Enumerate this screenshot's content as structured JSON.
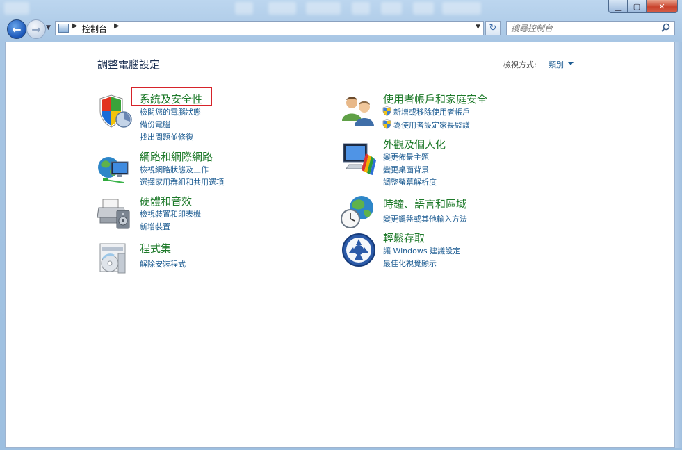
{
  "nav": {
    "breadcrumb": "控制台",
    "search_placeholder": "搜尋控制台"
  },
  "page": {
    "title": "調整電腦設定",
    "view_by_label": "檢視方式:",
    "view_by_value": "類別"
  },
  "left_categories": [
    {
      "title": "系統及安全性",
      "icon": "shield-computer-icon",
      "links": [
        "檢閱您的電腦狀態",
        "備份電腦",
        "找出問題並修復"
      ]
    },
    {
      "title": "網路和網際網路",
      "icon": "network-globe-icon",
      "links": [
        "檢視網路狀態及工作",
        "選擇家用群組和共用選項"
      ]
    },
    {
      "title": "硬體和音效",
      "icon": "printer-speaker-icon",
      "links": [
        "檢視裝置和印表機",
        "新增裝置"
      ]
    },
    {
      "title": "程式集",
      "icon": "programs-disc-icon",
      "links": [
        "解除安裝程式"
      ]
    }
  ],
  "right_categories": [
    {
      "title": "使用者帳戶和家庭安全",
      "icon": "users-icon",
      "links": [
        "新增或移除使用者帳戶",
        "為使用者設定家長監護"
      ]
    },
    {
      "title": "外觀及個人化",
      "icon": "appearance-monitor-icon",
      "links": [
        "變更佈景主題",
        "變更桌面背景",
        "調整螢幕解析度"
      ]
    },
    {
      "title": "時鐘、語言和區域",
      "icon": "clock-globe-icon",
      "links": [
        "變更鍵盤或其他輸入方法"
      ]
    },
    {
      "title": "輕鬆存取",
      "icon": "ease-of-access-icon",
      "links": [
        "讓 Windows 建議設定",
        "最佳化視覺顯示"
      ]
    }
  ],
  "colors": {
    "category_title": "#1e7a2a",
    "link": "#1d5c92",
    "highlight_box": "#d6232a"
  }
}
